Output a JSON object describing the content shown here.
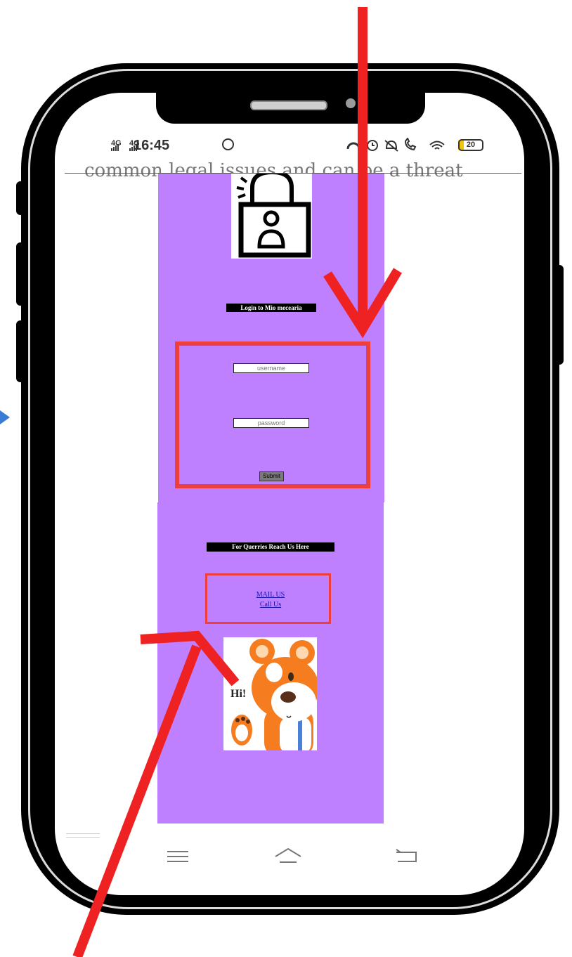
{
  "status_bar": {
    "network_1": "4G",
    "network_2": "4G",
    "time": "16:45",
    "battery": "20"
  },
  "background_text": "common legal issues and can be a threat",
  "login": {
    "title": "Login to Mio mecearia",
    "username_placeholder": "username",
    "password_placeholder": "password",
    "submit_label": "Submit"
  },
  "contact": {
    "title": "For Querries Reach Us Here",
    "mail_link": "MAIL US",
    "call_link": "Call Us"
  },
  "image": {
    "greeting": "Hi!"
  },
  "colors": {
    "page_background": "#bf80ff",
    "highlight_frame": "#ef3e3e",
    "annotation_arrow": "#ee2222",
    "side_arrow": "#3a7bd5"
  }
}
